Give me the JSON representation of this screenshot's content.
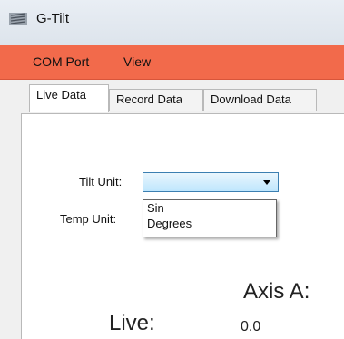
{
  "window": {
    "title": "G-Tilt",
    "icon": "app-icon"
  },
  "menubar": {
    "background": "#f26a4b",
    "items": [
      {
        "label": "COM Port"
      },
      {
        "label": "View"
      }
    ]
  },
  "tabs": [
    {
      "label": "Live Data",
      "active": true
    },
    {
      "label": "Record Data",
      "active": false
    },
    {
      "label": "Download Data",
      "active": false
    }
  ],
  "form": {
    "tilt_unit_label": "Tilt Unit:",
    "temp_unit_label": "Temp Unit:",
    "tilt_unit_value": "",
    "dropdown_open": true,
    "tilt_unit_options": [
      "Sin",
      "Degrees"
    ]
  },
  "readout": {
    "axis_title": "Axis A:",
    "live_label": "Live:",
    "live_value": "0.0"
  }
}
